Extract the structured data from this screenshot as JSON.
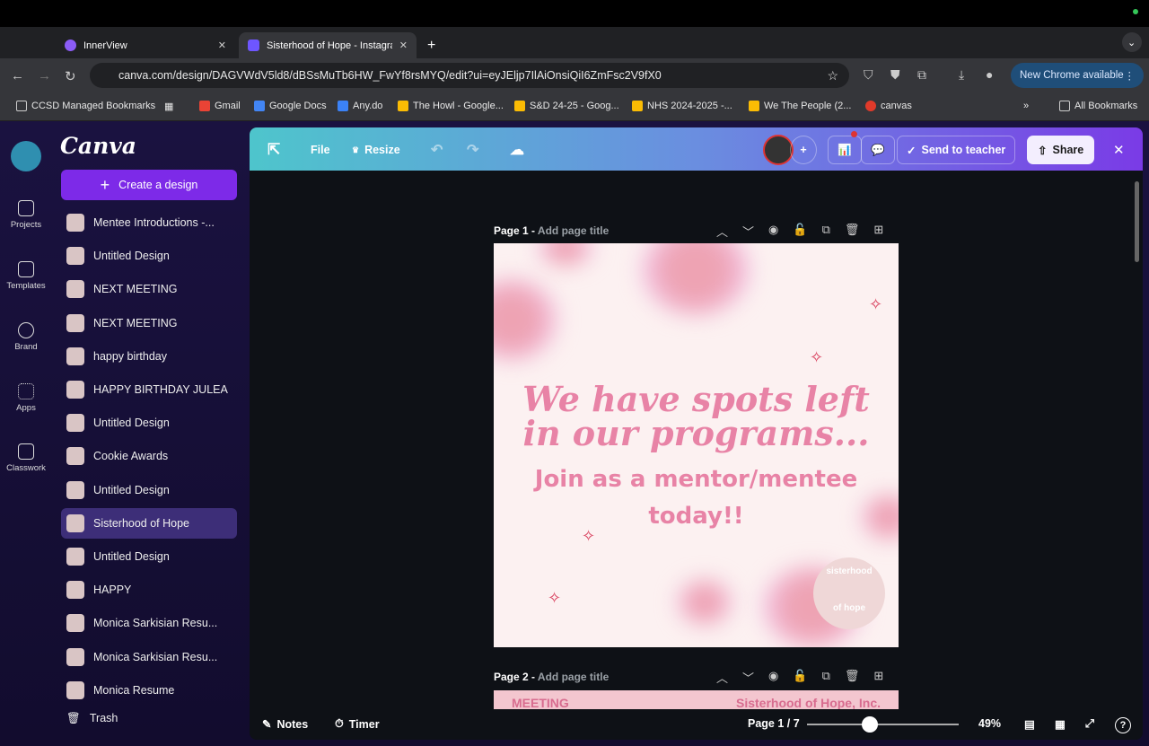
{
  "browser": {
    "tabs": [
      {
        "title": "InnerView"
      },
      {
        "title": "Sisterhood of Hope - Instagra"
      }
    ],
    "url": "canva.com/design/DAGVWdV5ld8/dBSsMuTb6HW_FwYf8rsMYQ/edit?ui=eyJEljp7IlAiOnsiQiI6ZmFsc2V9fX0",
    "new_chrome": "New Chrome available",
    "bookmarks": [
      "CCSD Managed Bookmarks",
      "Gmail",
      "Google Docs",
      "Any.do",
      "The Howl - Google...",
      "S&D 24-25 - Goog...",
      "NHS 2024-2025 -...",
      "We The People (2...",
      "canvas"
    ],
    "all_bookmarks": "All Bookmarks"
  },
  "rail": [
    {
      "label": "Projects"
    },
    {
      "label": "Templates"
    },
    {
      "label": "Brand"
    },
    {
      "label": "Apps"
    },
    {
      "label": "Classwork"
    }
  ],
  "panel": {
    "logo": "Canva",
    "create": "Create a design",
    "designs": [
      "Mentee Introductions -...",
      "Untitled Design",
      "NEXT MEETING",
      "NEXT MEETING",
      "happy birthday",
      "HAPPY BIRTHDAY JULEA",
      "Untitled Design",
      "Cookie Awards",
      "Untitled Design",
      "Sisterhood of Hope",
      "Untitled Design",
      "HAPPY",
      "Monica Sarkisian Resu...",
      "Monica Sarkisian Resu...",
      "Monica Resume"
    ],
    "trash": "Trash"
  },
  "toolbar": {
    "file": "File",
    "resize": "Resize",
    "send": "Send to teacher",
    "share": "Share"
  },
  "pages": [
    {
      "label": "Page 1 -",
      "title_placeholder": "Add page title"
    },
    {
      "label": "Page 2 -",
      "title_placeholder": "Add page title"
    }
  ],
  "design": {
    "headline1": "We have spots left",
    "headline2": "in our programs...",
    "sub1": "Join as a mentor/mentee",
    "sub2": "today!!",
    "badge_top": "sisterhood",
    "badge_bottom": "of hope",
    "page2_left": "MEETING",
    "page2_right": "Sisterhood of Hope, Inc."
  },
  "bottom": {
    "notes": "Notes",
    "timer": "Timer",
    "page": "Page 1 / 7",
    "zoom": "49%",
    "zoom_value": 49
  }
}
